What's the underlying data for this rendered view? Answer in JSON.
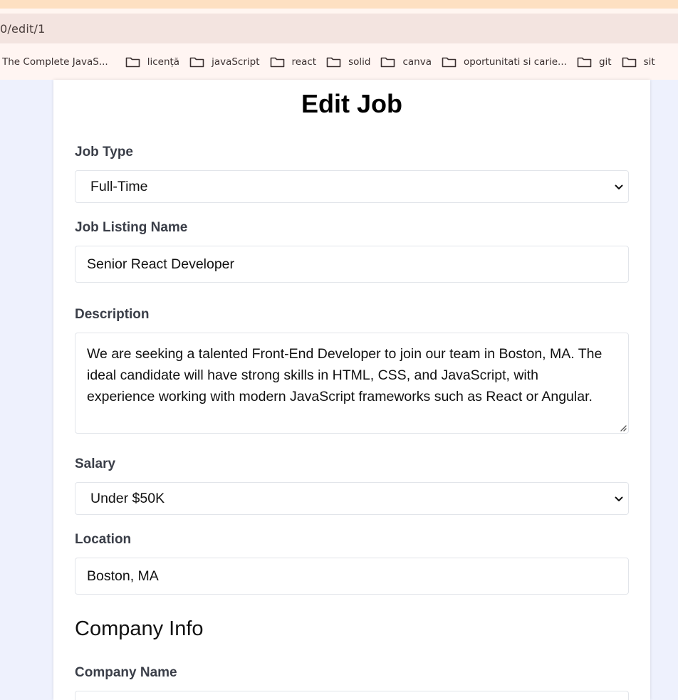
{
  "browser": {
    "url": "0/edit/1",
    "bookmarks": [
      {
        "label": "The Complete JavaS...",
        "icon": "none"
      },
      {
        "label": "licență",
        "icon": "folder-icon"
      },
      {
        "label": "javaScript",
        "icon": "folder-icon"
      },
      {
        "label": "react",
        "icon": "folder-icon"
      },
      {
        "label": "solid",
        "icon": "folder-icon"
      },
      {
        "label": "canva",
        "icon": "folder-icon"
      },
      {
        "label": "oportunitati si carie...",
        "icon": "folder-icon"
      },
      {
        "label": "git",
        "icon": "folder-icon"
      },
      {
        "label": "sit",
        "icon": "folder-icon"
      }
    ]
  },
  "form": {
    "title": "Edit Job",
    "job_type": {
      "label": "Job Type",
      "value": "Full-Time"
    },
    "listing_name": {
      "label": "Job Listing Name",
      "value": "Senior React Developer"
    },
    "description": {
      "label": "Description",
      "lines": [
        "We are seeking a talented Front-End Developer to join our team in Boston, MA. The",
        "ideal candidate will have strong skills in HTML, CSS, and JavaScript, with",
        "experience working with modern JavaScript frameworks such as React or Angular."
      ]
    },
    "salary": {
      "label": "Salary",
      "value": "Under $50K"
    },
    "location": {
      "label": "Location",
      "value": "Boston, MA"
    },
    "company_section_title": "Company Info",
    "company_name": {
      "label": "Company Name",
      "value": ""
    }
  },
  "colors": {
    "page_background": "#eef1fd",
    "card_background": "#ffffff",
    "label_text": "#3a3e48",
    "top_strip": "#fde0c2",
    "bookmark_bar": "#fff5f2"
  }
}
